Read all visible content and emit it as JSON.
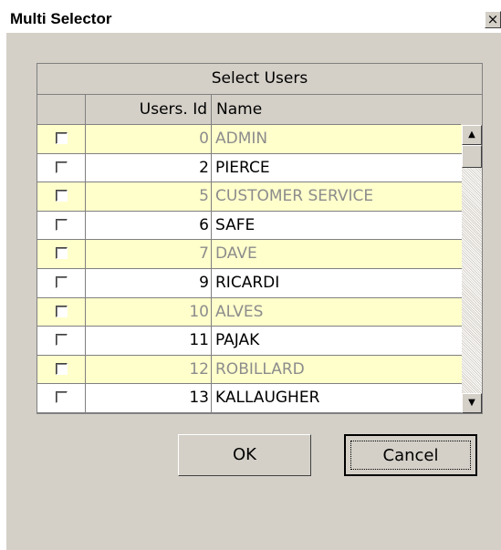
{
  "window": {
    "title": "Multi Selector",
    "close_glyph": "×"
  },
  "grid": {
    "caption": "Select Users",
    "columns": [
      "",
      "Users. Id",
      "Name"
    ],
    "rows": [
      {
        "id": "0",
        "name": "ADMIN",
        "checked": false,
        "dimmed": true
      },
      {
        "id": "2",
        "name": "PIERCE",
        "checked": false,
        "dimmed": false
      },
      {
        "id": "5",
        "name": "CUSTOMER SERVICE",
        "checked": false,
        "dimmed": true
      },
      {
        "id": "6",
        "name": "SAFE",
        "checked": false,
        "dimmed": false
      },
      {
        "id": "7",
        "name": "DAVE",
        "checked": false,
        "dimmed": true
      },
      {
        "id": "9",
        "name": "RICARDI",
        "checked": false,
        "dimmed": false
      },
      {
        "id": "10",
        "name": "ALVES",
        "checked": false,
        "dimmed": true
      },
      {
        "id": "11",
        "name": "PAJAK",
        "checked": false,
        "dimmed": false
      },
      {
        "id": "12",
        "name": "ROBILLARD",
        "checked": false,
        "dimmed": true
      },
      {
        "id": "13",
        "name": "KALLAUGHER",
        "checked": false,
        "dimmed": false
      }
    ],
    "scroll_up_glyph": "▲",
    "scroll_down_glyph": "▼"
  },
  "buttons": {
    "ok": "OK",
    "cancel": "Cancel"
  },
  "colors": {
    "dimmed_row_bg": "#ffffcc",
    "dimmed_text": "#8c8c8c",
    "normal_row_bg": "#ffffff",
    "normal_text": "#000000",
    "dialog_bg": "#d4d0c8"
  }
}
